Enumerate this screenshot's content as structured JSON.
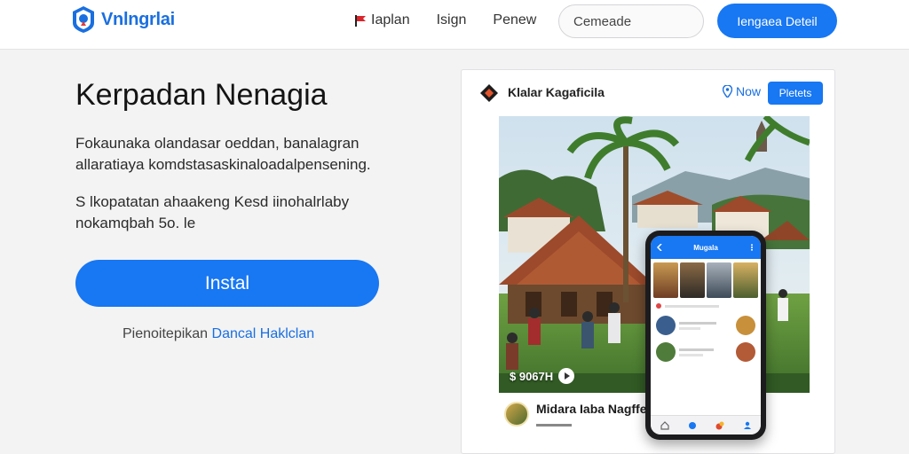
{
  "header": {
    "brand": "Vnlngrlai",
    "nav": [
      {
        "label": "Iaplan",
        "icon": "flag-icon"
      },
      {
        "label": "Isign"
      },
      {
        "label": "Penew"
      }
    ],
    "search": {
      "placeholder": "Cemeade"
    },
    "cta": "Iengaea Deteil"
  },
  "hero": {
    "title": "Kerpadan Nenagia",
    "description": "Fokaunaka olandasar oeddan, banalagran allaratiaya komdstasaskinaloadalpensening.",
    "note": "S lkopatatan ahaakeng Kesd iinohalrlaby nokamqbah 5o. le",
    "install_label": "Instal",
    "footer_prefix": "Pienoitepikan",
    "footer_link": "Dancal Haklclan"
  },
  "preview": {
    "title": "Klalar Kagaficila",
    "now_label": "Now",
    "button_label": "Pletets",
    "photo_label": "$ 9067H",
    "post_title": "Midara Iaba Nagffe",
    "post_sub": "▬▬▬▬",
    "phone": {
      "header": "Mugala"
    }
  },
  "colors": {
    "accent": "#1877f2",
    "link": "#1a6fe0",
    "background": "#f3f3f4"
  }
}
